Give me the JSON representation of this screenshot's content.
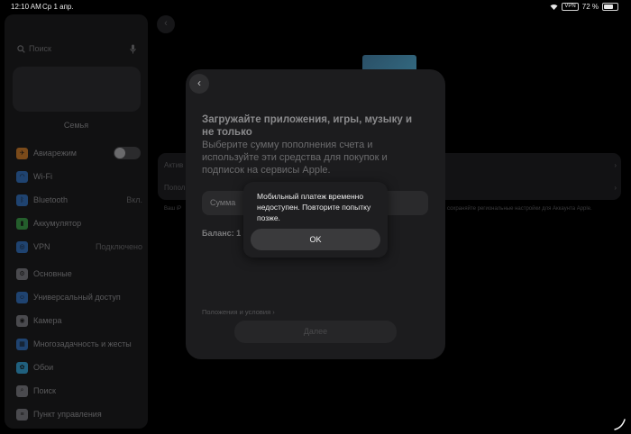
{
  "status_bar": {
    "time": "12:10 AM",
    "date": "Ср 1 апр.",
    "vpn": "VPN",
    "battery": "72 %",
    "battery_level": 0.72
  },
  "sidebar": {
    "search_placeholder": "Поиск",
    "family_label": "Семья",
    "items": [
      {
        "label": "Авиарежим",
        "icon": "airplane-icon",
        "color": "#f0932b",
        "toggle": false
      },
      {
        "label": "Wi-Fi",
        "icon": "wifi-icon",
        "color": "#2f7ae5"
      },
      {
        "label": "Bluetooth",
        "icon": "bluetooth-icon",
        "color": "#2f7ae5",
        "value": "Вкл."
      },
      {
        "label": "Аккумулятор",
        "icon": "battery-icon",
        "color": "#3db94a"
      },
      {
        "label": "VPN",
        "icon": "vpn-icon",
        "color": "#2f7ae5",
        "value": "Подключено"
      },
      {
        "label": "Основные",
        "icon": "gear-icon",
        "color": "#8e8e93"
      },
      {
        "label": "Универсальный доступ",
        "icon": "accessibility-icon",
        "color": "#2f7ae5"
      },
      {
        "label": "Камера",
        "icon": "camera-icon",
        "color": "#8e8e93"
      },
      {
        "label": "Многозадачность и жесты",
        "icon": "multitasking-icon",
        "color": "#2f7ae5"
      },
      {
        "label": "Обои",
        "icon": "wallpaper-icon",
        "color": "#38a8e0"
      },
      {
        "label": "Поиск",
        "icon": "search-icon",
        "color": "#8e8e93"
      },
      {
        "label": "Пункт управления",
        "icon": "control-center-icon",
        "color": "#8e8e93"
      }
    ]
  },
  "background": {
    "row1": "Актив",
    "row2": "Попол",
    "note_left": "Ваш iP",
    "note_right": "сохраняйте региональные настройки для Аккаунта Apple."
  },
  "sheet": {
    "heading": "Загружайте приложения, игры, музыку и не только",
    "subtext": "Выберите сумму пополнения счета и используйте эти средства для покупок и подписок на сервисы Apple.",
    "amount_label": "Сумма",
    "balance": "Баланс: 1 8",
    "terms": "Положения и условия ›",
    "continue": "Далее"
  },
  "alert": {
    "message": "Мобильный платеж временно недоступен. Повторите попытку позже.",
    "ok": "OK"
  },
  "colors": {
    "accent": "#2f7ae5",
    "sheet_bg": "#1c1c1e",
    "alert_bg": "#1e1e20"
  }
}
